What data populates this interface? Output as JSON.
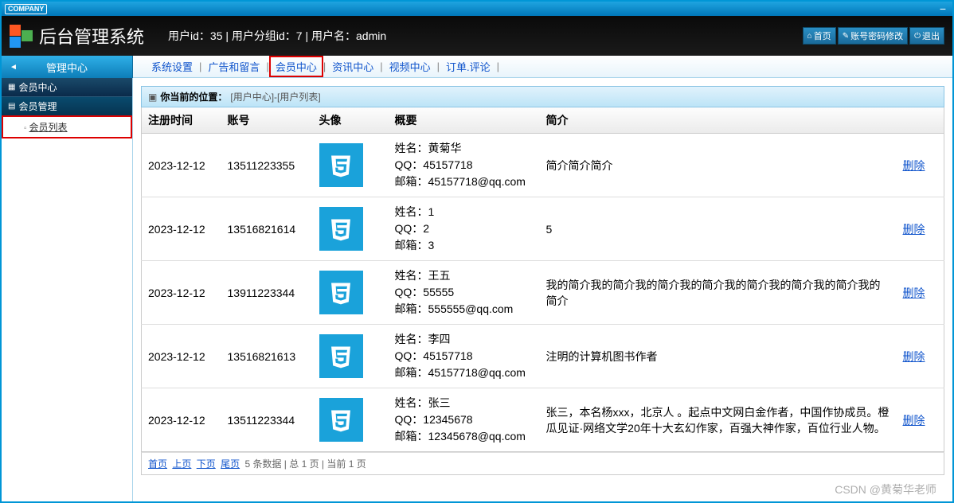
{
  "titlebar": {
    "company": "COMPANY"
  },
  "header": {
    "app_title": "后台管理系统",
    "user_info": "用户id：35 | 用户分组id：7 | 用户名：admin",
    "home": "首页",
    "password": "账号密码修改",
    "logout": "退出"
  },
  "sidebar": {
    "head": "管理中心",
    "group": "会员中心",
    "subgroup": "会员管理",
    "item": "会员列表"
  },
  "topnav": {
    "items": [
      "系统设置",
      "广告和留言",
      "会员中心",
      "资讯中心",
      "视频中心",
      "订单.评论"
    ],
    "highlighted_index": 2
  },
  "breadcrumb": {
    "label": "你当前的位置：",
    "path": "[用户中心]-[用户列表]"
  },
  "table": {
    "headers": [
      "注册时间",
      "账号",
      "头像",
      "概要",
      "简介",
      ""
    ],
    "summary_labels": {
      "name": "姓名：",
      "qq": "QQ：",
      "email": "邮箱："
    },
    "action_label": "删除",
    "rows": [
      {
        "time": "2023-12-12",
        "account": "13511223355",
        "name": "黄菊华",
        "qq": "45157718",
        "email": "45157718@qq.com",
        "intro": "简介简介简介"
      },
      {
        "time": "2023-12-12",
        "account": "13516821614",
        "name": "1",
        "qq": "2",
        "email": "3",
        "intro": "5"
      },
      {
        "time": "2023-12-12",
        "account": "13911223344",
        "name": "王五",
        "qq": "55555",
        "email": "555555@qq.com",
        "intro": "我的简介我的简介我的简介我的简介我的简介我的简介我的简介我的简介"
      },
      {
        "time": "2023-12-12",
        "account": "13516821613",
        "name": "李四",
        "qq": "45157718",
        "email": "45157718@qq.com",
        "intro": "注明的计算机图书作者"
      },
      {
        "time": "2023-12-12",
        "account": "13511223344",
        "name": "张三",
        "qq": "12345678",
        "email": "12345678@qq.com",
        "intro": "张三，本名杨xxx，北京人 。起点中文网白金作者，中国作协成员。橙瓜见证·网络文学20年十大玄幻作家，百强大神作家，百位行业人物。"
      }
    ]
  },
  "pager": {
    "first": "首页",
    "prev": "上页",
    "next": "下页",
    "last": "尾页",
    "info": "5 条数据 | 总 1 页 | 当前 1 页"
  },
  "watermark": "CSDN @黄菊华老师"
}
